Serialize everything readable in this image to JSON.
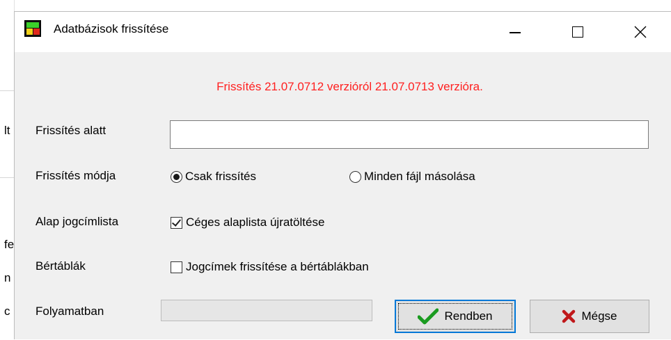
{
  "window": {
    "title": "Adatbázisok frissítése",
    "accent_color": "#0078d7"
  },
  "message": {
    "text": "Frissítés 21.07.0712 verzióról 21.07.0713 verzióra.",
    "color": "#ff2020"
  },
  "fields": {
    "during_update": {
      "label": "Frissítés alatt",
      "value": ""
    },
    "update_mode": {
      "label": "Frissítés módja",
      "options": [
        {
          "label": "Csak frissítés",
          "selected": true
        },
        {
          "label": "Minden fájl másolása",
          "selected": false
        }
      ]
    },
    "base_list": {
      "label": "Alap jogcímlista",
      "checkbox": {
        "label": "Céges alaplista újratöltése",
        "checked": true
      }
    },
    "wage_tables": {
      "label": "Bértáblák",
      "checkbox": {
        "label": "Jogcímek frissítése a bértáblákban",
        "checked": false
      }
    },
    "progress": {
      "label": "Folyamatban",
      "value_percent": 0
    }
  },
  "buttons": {
    "ok": {
      "label": "Rendben",
      "icon": "checkmark-icon",
      "icon_color": "#1a9b20"
    },
    "cancel": {
      "label": "Mégse",
      "icon": "x-icon",
      "icon_color": "#c0181b"
    }
  },
  "background": {
    "fragments": [
      "lt",
      "fe",
      "n",
      "c"
    ]
  }
}
